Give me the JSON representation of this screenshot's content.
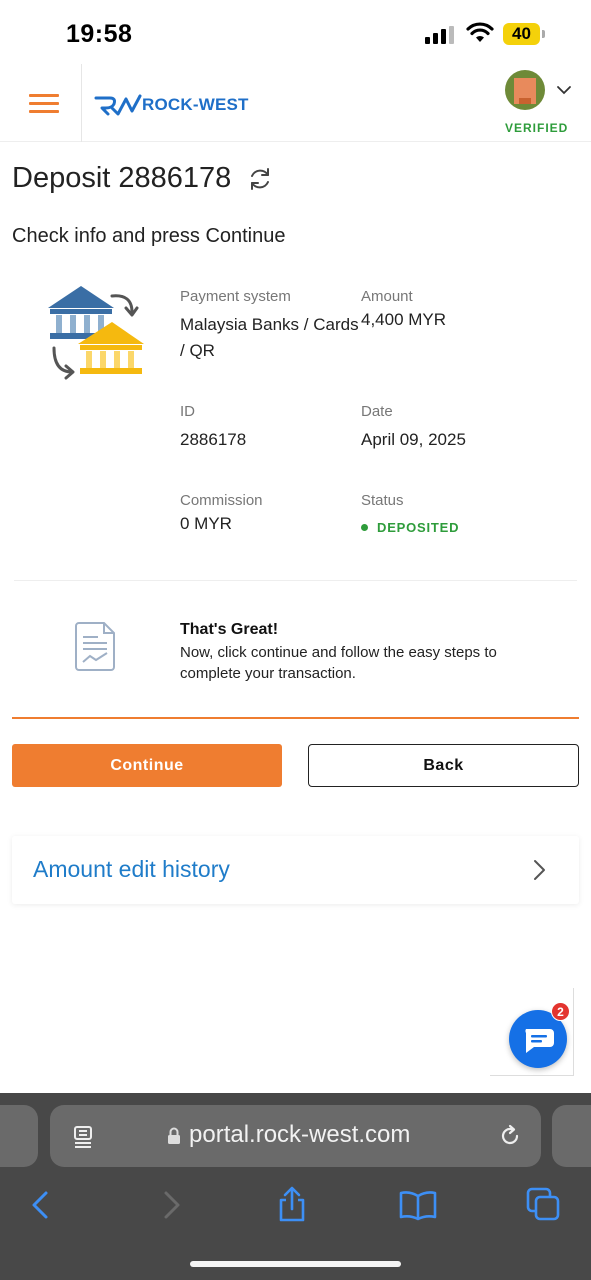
{
  "status_bar": {
    "time": "19:58",
    "battery": "40"
  },
  "header": {
    "logo_text": "ROCK-WEST",
    "verified": "VERIFIED"
  },
  "page": {
    "title": "Deposit 2886178",
    "subtitle": "Check info and press Continue"
  },
  "details": {
    "payment_system_label": "Payment system",
    "payment_system_value_1": "Malaysia Banks / Cards",
    "payment_system_value_2": "/ QR",
    "amount_label": "Amount",
    "amount_value": "4,400 MYR",
    "id_label": "ID",
    "id_value": "2886178",
    "date_label": "Date",
    "date_value": "April 09, 2025",
    "commission_label": "Commission",
    "commission_value": "0 MYR",
    "status_label": "Status",
    "status_value": "DEPOSITED"
  },
  "notice": {
    "title": "That's Great!",
    "text": "Now, click continue and follow the easy steps to complete your transaction."
  },
  "buttons": {
    "continue": "Continue",
    "back": "Back"
  },
  "history": {
    "label": "Amount edit history"
  },
  "chat": {
    "badge_count": "2"
  },
  "browser": {
    "url": "portal.rock-west.com"
  },
  "colors": {
    "accent": "#ef7d30",
    "link": "#1f7cc9",
    "success": "#2e9c3b",
    "brand_blue": "#1f6fc8"
  },
  "icons": [
    "hamburger-icon",
    "refresh-icon",
    "bank-transfer-icon",
    "document-icon",
    "chevron-right-icon",
    "chat-icon",
    "lock-icon",
    "reload-icon",
    "back-icon",
    "forward-icon",
    "share-icon",
    "bookmarks-icon",
    "tabs-icon"
  ]
}
